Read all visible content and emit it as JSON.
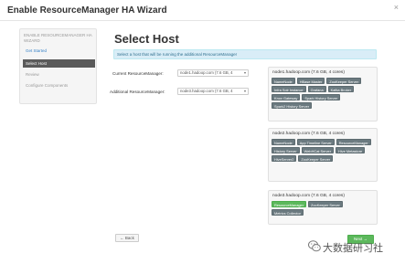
{
  "window": {
    "title": "Enable ResourceManager HA Wizard",
    "close": "×"
  },
  "sidebar": {
    "heading": "ENABLE RESOURCEMANAGER HA WIZARD",
    "items": [
      {
        "label": "Get Started",
        "state": "done"
      },
      {
        "label": "Select Host",
        "state": "active"
      },
      {
        "label": "Review",
        "state": "pending"
      },
      {
        "label": "Configure Components",
        "state": "pending"
      }
    ]
  },
  "main": {
    "title": "Select Host",
    "alert": "Select a host that will be running the additional ResourceManager",
    "fields": [
      {
        "label": "Current ResourceManager:",
        "value": "node1.hadoop.com (7.6 GB, 4"
      },
      {
        "label": "Additional ResourceManager:",
        "value": "node3.hadoop.com (7.6 GB, 4"
      }
    ],
    "hosts": [
      {
        "name": "node1.hadoop.com (7.6 GB, 4 cores)",
        "components": [
          {
            "label": "NameNode",
            "is_new": false
          },
          {
            "label": "HBase Master",
            "is_new": false
          },
          {
            "label": "ZooKeeper Server",
            "is_new": false
          },
          {
            "label": "Infra Solr Instance",
            "is_new": false
          },
          {
            "label": "Grafana",
            "is_new": false
          },
          {
            "label": "Kafka Broker",
            "is_new": false
          },
          {
            "label": "Knox Gateway",
            "is_new": false
          },
          {
            "label": "Spark History Server",
            "is_new": false
          },
          {
            "label": "Spark2 History Server",
            "is_new": false
          }
        ]
      },
      {
        "name": "node2.hadoop.com (7.6 GB, 4 cores)",
        "components": [
          {
            "label": "NameNode",
            "is_new": false
          },
          {
            "label": "App Timeline Server",
            "is_new": false
          },
          {
            "label": "ResourceManager",
            "is_new": false
          },
          {
            "label": "History Server",
            "is_new": false
          },
          {
            "label": "WebHCat Server",
            "is_new": false
          },
          {
            "label": "Hive Metastore",
            "is_new": false
          },
          {
            "label": "HiveServer2",
            "is_new": false
          },
          {
            "label": "ZooKeeper Server",
            "is_new": false
          }
        ]
      },
      {
        "name": "node3.hadoop.com (7.6 GB, 4 cores)",
        "components": [
          {
            "label": "ResourceManager",
            "is_new": true
          },
          {
            "label": "ZooKeeper Server",
            "is_new": false
          },
          {
            "label": "Metrics Collector",
            "is_new": false
          }
        ]
      }
    ],
    "back_label": "← Back",
    "next_label": "Next →"
  },
  "watermark": {
    "text": "大数据研习社",
    "icon": "wechat-icon"
  },
  "colors": {
    "accent_green": "#5cb85c",
    "component_badge": "#6b7a80",
    "sidebar_active": "#5a5a5a",
    "alert_bg": "#d9edf7",
    "link": "#3a84c8"
  }
}
